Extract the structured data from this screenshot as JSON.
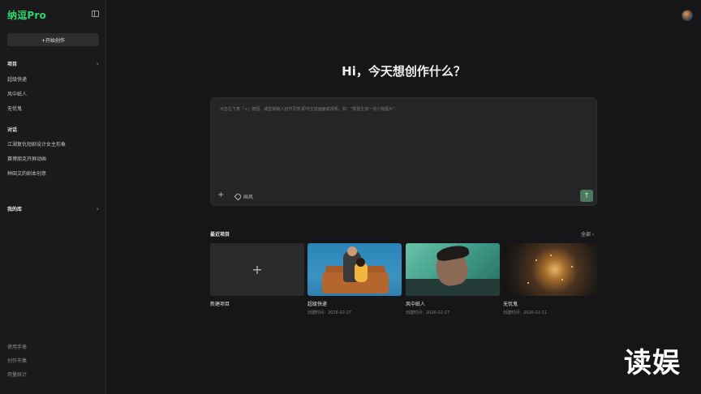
{
  "app": {
    "logo": "纳逗Pro"
  },
  "sidebar": {
    "new_button": "+开始创作",
    "projects_header": "项目",
    "projects": [
      {
        "label": "超级快递"
      },
      {
        "label": "风中纸人"
      },
      {
        "label": "无忧鬼"
      }
    ],
    "chats_header": "对话",
    "chats": [
      {
        "label": "江湖复仇短剧设计女主形象"
      },
      {
        "label": "赛博朋克开屏动画"
      },
      {
        "label": "种田文的剧本创意"
      }
    ],
    "library_header": "我的库",
    "footer": [
      {
        "label": "使用手册"
      },
      {
        "label": "创作市集"
      },
      {
        "label": "用量统计"
      }
    ]
  },
  "main": {
    "greeting": "Hi，今天想创作什么？",
    "prompt": {
      "placeholder": "点击左下角「+」按钮，或直接输入创作灵感,即可生成画面或视频。如：“帮我生成一张小狗图片”。",
      "style_label": "画风"
    },
    "recent": {
      "title": "最近项目",
      "all_label": "全部 ›",
      "cards": [
        {
          "title": "新建项目",
          "date": ""
        },
        {
          "title": "超级快递",
          "date": "创建时间：2026-02-27"
        },
        {
          "title": "风中纸人",
          "date": "创建时间：2026-02-27"
        },
        {
          "title": "无忧鬼",
          "date": "创建时间：2026-02-11"
        }
      ]
    }
  },
  "watermark": "读娱",
  "icons": [
    "sidebar-toggle-icon",
    "chevron-right-icon",
    "plus-icon",
    "tag-icon",
    "arrow-up-icon",
    "avatar"
  ],
  "colors": {
    "brand": "#2fd46a",
    "send_button": "#4b7a5e",
    "background": "#161618"
  }
}
